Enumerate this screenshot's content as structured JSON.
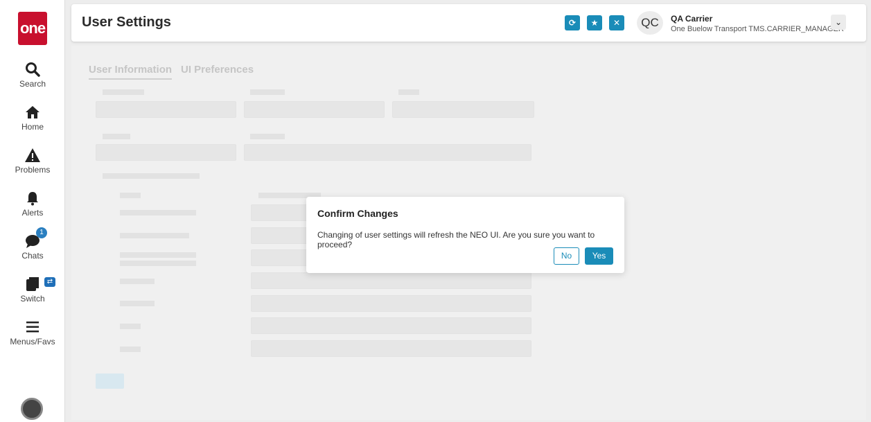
{
  "app": {
    "logo_text": "one"
  },
  "sidebar": {
    "items": [
      {
        "label": "Search",
        "icon": "search-icon"
      },
      {
        "label": "Home",
        "icon": "home-icon"
      },
      {
        "label": "Problems",
        "icon": "warning-icon"
      },
      {
        "label": "Alerts",
        "icon": "bell-icon"
      },
      {
        "label": "Chats",
        "icon": "chat-icon",
        "badge": "1"
      },
      {
        "label": "Switch",
        "icon": "switch-icon"
      },
      {
        "label": "Menus/Favs",
        "icon": "menu-icon"
      }
    ]
  },
  "header": {
    "title": "User Settings",
    "user_initials": "QC",
    "user_name": "QA Carrier",
    "user_org": "One Buelow Transport TMS.CARRIER_MANAGER",
    "colors": {
      "accent": "#1a8cb8"
    }
  },
  "tabs": [
    {
      "label": "User Information"
    },
    {
      "label": "UI Preferences"
    }
  ],
  "modal": {
    "title": "Confirm Changes",
    "message": "Changing of user settings will refresh the NEO UI. Are you sure you want to proceed?",
    "no_label": "No",
    "yes_label": "Yes"
  }
}
